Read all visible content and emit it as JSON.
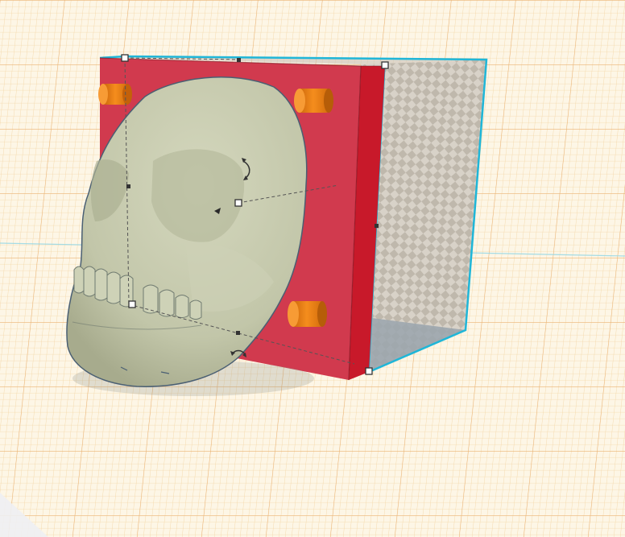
{
  "app": {
    "view": "3d-workplane",
    "grid_visible": true
  },
  "colors": {
    "grid_background": "#fdf6e6",
    "grid_minor_line": "#f3d5a3",
    "grid_major_line": "#eab373",
    "workplane_axis": "#8fd6e6",
    "mold_box_front": "#d13a4e",
    "mold_box_side": "#cc1a2a",
    "hole_box_outline": "#1fb6d8",
    "hole_box_fill": "#c9c2b7",
    "skull": "#c5c9ad",
    "skull_shadow": "#9ea285",
    "peg": "#ef7f12",
    "peg_dark": "#b65d08",
    "handle": "#ffffff",
    "handle_stroke": "#333333"
  },
  "scene": {
    "objects": [
      {
        "name": "mold-box",
        "shape": "box",
        "type": "solid",
        "color": "red"
      },
      {
        "name": "hole-box",
        "shape": "box",
        "type": "hole",
        "selected": true
      },
      {
        "name": "skull",
        "shape": "imported-mesh",
        "type": "solid",
        "selected": true
      },
      {
        "name": "peg-top-left",
        "shape": "cylinder",
        "type": "solid",
        "color": "orange"
      },
      {
        "name": "peg-top-right",
        "shape": "cylinder",
        "type": "solid",
        "color": "orange"
      },
      {
        "name": "peg-bottom-right",
        "shape": "cylinder",
        "type": "solid",
        "color": "orange"
      }
    ],
    "controls": [
      {
        "name": "rotate-arrow-top",
        "icon": "rotate-arrow-icon"
      },
      {
        "name": "rotate-arrow-bottom",
        "icon": "rotate-arrow-icon"
      },
      {
        "name": "resize-handle",
        "icon": "square-handle-icon"
      }
    ]
  }
}
